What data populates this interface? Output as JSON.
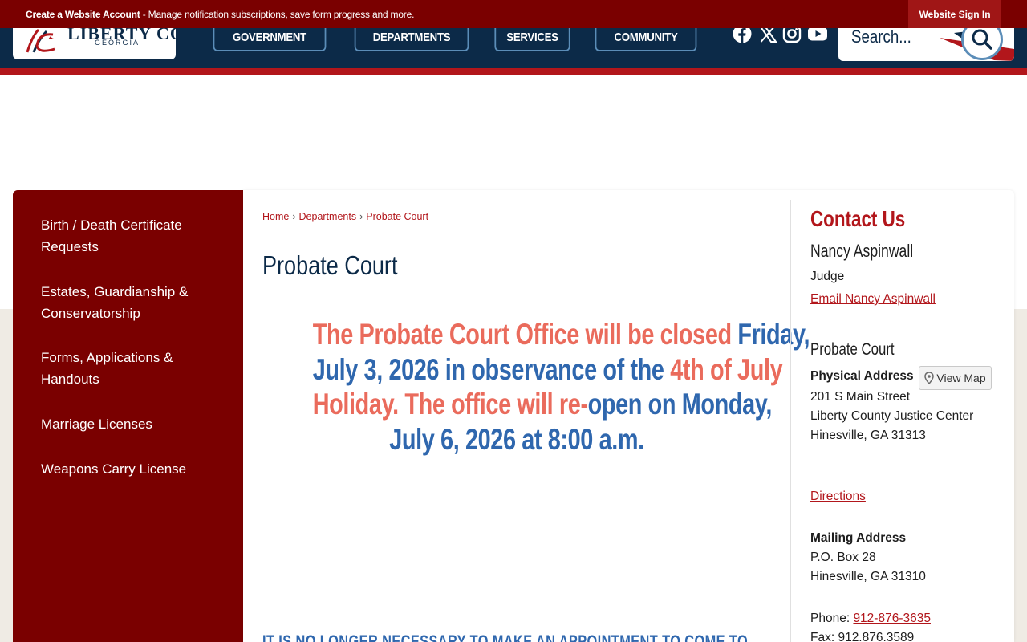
{
  "topbar": {
    "create_account": "Create a Website Account",
    "notice_rest": " - Manage notification subscriptions, save form progress and more.",
    "sign_in": "Website Sign In"
  },
  "logo": {
    "name": "LIBERTY COUNTY",
    "state": "GEORGIA"
  },
  "nav": {
    "government": "GOVERNMENT",
    "departments": "DEPARTMENTS",
    "services": "SERVICES",
    "community": "COMMUNITY"
  },
  "social_icons": [
    "facebook-icon",
    "x-icon",
    "instagram-icon",
    "youtube-icon"
  ],
  "search": {
    "placeholder": "Search..."
  },
  "sidebar": {
    "items": [
      {
        "label": "Birth / Death Certificate Requests"
      },
      {
        "label": "Estates, Guardianship & Conservatorship"
      },
      {
        "label": "Forms, Applications & Handouts"
      },
      {
        "label": "Marriage Licenses"
      },
      {
        "label": "Weapons Carry License"
      }
    ]
  },
  "breadcrumb": {
    "home": "Home",
    "departments": "Departments",
    "current": "Probate Court",
    "separator": "›"
  },
  "page_title": "Probate Court",
  "announcement": {
    "l1a": "The Probate Court Office will be closed ",
    "l1b": "Friday,",
    "l2a": "July 3, 2026 in observance of the ",
    "l2b": "4th of July",
    "l3a": "Holiday. The office will re-",
    "l3b": "open on Monday,",
    "l4": "July 6, 2026 at 8:00 a.m."
  },
  "notice_cut": "IT IS NO LONGER NECESSARY TO MAKE AN APPOINTMENT TO COME TO",
  "contact": {
    "heading": "Contact Us",
    "person": "Nancy Aspinwall",
    "role": "Judge",
    "email_link": "Email Nancy Aspinwall",
    "office": "Probate Court",
    "physical_label": "Physical Address",
    "view_map": "View Map",
    "addr1": "201 S Main Street",
    "addr2": "Liberty County Justice Center",
    "addr3": "Hinesville, GA 31313",
    "directions": "Directions",
    "mailing_label": "Mailing Address",
    "mail1": "P.O. Box 28",
    "mail2": "Hinesville, GA 31310",
    "phone_label": "Phone: ",
    "phone": "912-876-3635",
    "fax": "Fax: 912.876.3589"
  },
  "colors": {
    "maroon": "#7a0000",
    "navy": "#0c2a48",
    "accent_red": "#b2161b",
    "announce_red": "#ea6b5c",
    "announce_blue": "#2f67ae"
  }
}
